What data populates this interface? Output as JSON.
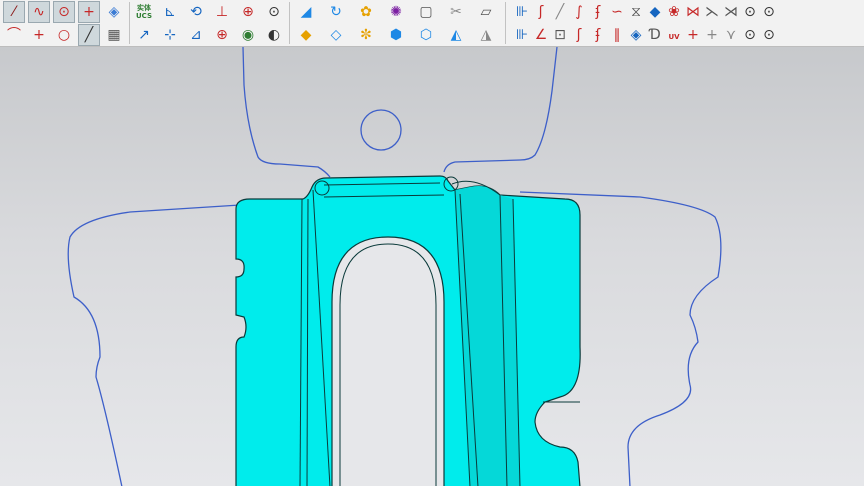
{
  "toolbar": {
    "row1": [
      {
        "name": "line-tool-icon",
        "glyph": "⁄",
        "color": "#8b1a1a",
        "active": true
      },
      {
        "name": "polyline-tool-icon",
        "glyph": "∿",
        "color": "#c62828",
        "active": true
      },
      {
        "name": "circle-center-tool-icon",
        "glyph": "⊙",
        "color": "#c62828",
        "active": true
      },
      {
        "name": "point-tool-icon",
        "glyph": "+",
        "color": "#c62828",
        "active": true
      },
      {
        "name": "sketch-plane-icon",
        "glyph": "◈",
        "color": "#3b7bd4",
        "active": false
      },
      {
        "name": "entity-ucs-icon",
        "label": "实体\nUCS",
        "color": "#2e7d32"
      },
      {
        "name": "ucs-move-icon",
        "glyph": "⊾",
        "color": "#1565c0"
      },
      {
        "name": "ucs-rotate-icon",
        "glyph": "⟲",
        "color": "#1565c0"
      },
      {
        "name": "ucs-align-icon",
        "glyph": "⊥",
        "color": "#c62828"
      },
      {
        "name": "ucs-save-icon",
        "glyph": "⊕",
        "color": "#c62828"
      },
      {
        "name": "ucs-dynamic-icon",
        "glyph": "⊙",
        "color": "#333333"
      },
      {
        "name": "surface-extrude-icon",
        "glyph": "◢",
        "color": "#1e88e5"
      },
      {
        "name": "surface-revolve-icon",
        "glyph": "↻",
        "color": "#1e88e5"
      },
      {
        "name": "surface-sweep-icon",
        "glyph": "✿",
        "color": "#e6a100"
      },
      {
        "name": "surface-loft-icon",
        "glyph": "✺",
        "color": "#7b1fa2"
      },
      {
        "name": "document-icon",
        "glyph": "▢",
        "color": "#555555"
      },
      {
        "name": "trim-surface-icon",
        "glyph": "✂",
        "color": "#888888"
      },
      {
        "name": "plane-surface-icon",
        "glyph": "▱",
        "color": "#555555"
      },
      {
        "name": "curve-project-icon",
        "glyph": "⊪",
        "color": "#1565c0"
      },
      {
        "name": "curve-wrap-icon",
        "glyph": "ʃ",
        "color": "#c62828"
      },
      {
        "name": "curve-diagonal-icon",
        "glyph": "╱",
        "color": "#888888"
      },
      {
        "name": "curve-intersect-icon",
        "glyph": "∫",
        "color": "#c62828"
      },
      {
        "name": "curve-offset-icon",
        "glyph": "ʄ",
        "color": "#c62828"
      },
      {
        "name": "curve-blend-icon",
        "glyph": "∽",
        "color": "#c62828"
      },
      {
        "name": "curve-extract-icon",
        "glyph": "⧖",
        "color": "#555555"
      },
      {
        "name": "curve-surface-icon",
        "glyph": "◆",
        "color": "#1565c0"
      },
      {
        "name": "curve-boundary-icon",
        "glyph": "❀",
        "color": "#c62828"
      },
      {
        "name": "curve-iso-icon",
        "glyph": "⋈",
        "color": "#c62828"
      },
      {
        "name": "curve-split-icon",
        "glyph": "⋋",
        "color": "#555555"
      },
      {
        "name": "curve-cross-icon",
        "glyph": "⋊",
        "color": "#555555"
      },
      {
        "name": "curve-circle-icon",
        "glyph": "⊙",
        "color": "#333333"
      },
      {
        "name": "curve-circle-2-icon",
        "glyph": "⊙",
        "color": "#333333"
      }
    ],
    "row2": [
      {
        "name": "arc-tool-icon",
        "glyph": "⌒",
        "color": "#c62828",
        "active": false
      },
      {
        "name": "crosshair-tool-icon",
        "glyph": "+",
        "color": "#c62828",
        "active": false
      },
      {
        "name": "circle-tool-icon",
        "glyph": "○",
        "color": "#c62828",
        "active": false
      },
      {
        "name": "diagonal-line-tool-icon",
        "glyph": "╱",
        "color": "#333333",
        "active": true
      },
      {
        "name": "grid-tool-icon",
        "glyph": "▦",
        "color": "#555555",
        "active": false
      },
      {
        "name": "ucs-axis-icon",
        "glyph": "↗",
        "color": "#1565c0"
      },
      {
        "name": "ucs-origin-icon",
        "glyph": "⊹",
        "color": "#1565c0"
      },
      {
        "name": "ucs-object-icon",
        "glyph": "⊿",
        "color": "#1565c0"
      },
      {
        "name": "ucs-move-2-icon",
        "glyph": "⊕",
        "color": "#c62828"
      },
      {
        "name": "ucs-shape-icon",
        "glyph": "◉",
        "color": "#2e7d32"
      },
      {
        "name": "ucs-plane-icon",
        "glyph": "◐",
        "color": "#333333"
      },
      {
        "name": "surface-net-icon",
        "glyph": "◆",
        "color": "#e6a100"
      },
      {
        "name": "surface-patch-icon",
        "glyph": "◇",
        "color": "#1e88e5"
      },
      {
        "name": "surface-fill-icon",
        "glyph": "✼",
        "color": "#e6a100"
      },
      {
        "name": "surface-box-icon",
        "glyph": "⬢",
        "color": "#1e88e5"
      },
      {
        "name": "surface-cylinder-icon",
        "glyph": "⬡",
        "color": "#1e88e5"
      },
      {
        "name": "surface-split-icon",
        "glyph": "◭",
        "color": "#1e88e5"
      },
      {
        "name": "surface-offset-icon",
        "glyph": "◮",
        "color": "#888888"
      },
      {
        "name": "curve-edge-icon",
        "glyph": "⊪",
        "color": "#1565c0"
      },
      {
        "name": "curve-angle-icon",
        "glyph": "∠",
        "color": "#c62828"
      },
      {
        "name": "curve-page-icon",
        "glyph": "⊡",
        "color": "#555555"
      },
      {
        "name": "curve-spiral-icon",
        "glyph": "ʃ",
        "color": "#c62828"
      },
      {
        "name": "curve-spiral-2-icon",
        "glyph": "ʄ",
        "color": "#c62828"
      },
      {
        "name": "curve-slash-icon",
        "glyph": "∥",
        "color": "#c62828"
      },
      {
        "name": "curve-tile-icon",
        "glyph": "◈",
        "color": "#1565c0"
      },
      {
        "name": "curve-d-icon",
        "glyph": "Ɗ",
        "color": "#555555"
      },
      {
        "name": "uv-curve-icon",
        "label": "UV",
        "color": "#c62828"
      },
      {
        "name": "curve-plus-icon",
        "glyph": "+",
        "color": "#c62828"
      },
      {
        "name": "curve-plus-2-icon",
        "glyph": "+",
        "color": "#888888"
      },
      {
        "name": "curve-merge-icon",
        "glyph": "⋎",
        "color": "#888888"
      },
      {
        "name": "curve-circle-3-icon",
        "glyph": "⊙",
        "color": "#333333"
      },
      {
        "name": "curve-circle-4-icon",
        "glyph": "⊙",
        "color": "#333333"
      }
    ]
  },
  "colors": {
    "part_fill": "#00ecec",
    "part_edge": "#0a3a3a",
    "curve_blue": "#3d5fc9",
    "viewport_top": "#c7c9cc",
    "viewport_bottom": "#e6e7ea"
  }
}
